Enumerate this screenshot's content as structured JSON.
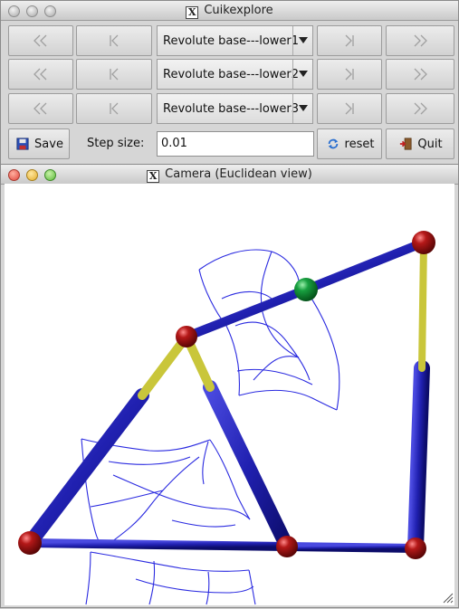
{
  "main_window": {
    "title": "Cuikexplore",
    "rows": [
      {
        "joint": "Revolute base---lower1"
      },
      {
        "joint": "Revolute base---lower2"
      },
      {
        "joint": "Revolute base---lower3"
      }
    ],
    "save_label": "Save",
    "step_label": "Step size:",
    "step_value": "0.01",
    "reset_label": "reset",
    "quit_label": "Quit"
  },
  "camera_window": {
    "title": "Camera (Euclidean view)"
  },
  "colors": {
    "link_blue": "#2222aa",
    "link_yellow": "#c9c63a",
    "joint_red": "#9c0f10",
    "joint_green": "#149430",
    "wire_blue": "#2a2ae0"
  }
}
